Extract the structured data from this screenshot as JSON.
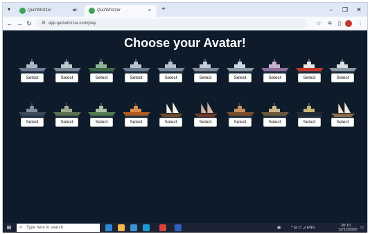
{
  "browser": {
    "tabs": [
      {
        "title": "QuizWhizzer",
        "active": false
      },
      {
        "title": "QuizWhizzer",
        "active": true
      }
    ],
    "tab_menu_icon": "▾",
    "mute_icon": "◀×",
    "close_icon": "×",
    "new_tab_icon": "+",
    "window_controls": {
      "minimize": "–",
      "restore": "❐",
      "close": "✕"
    },
    "nav": {
      "back": "←",
      "forward": "→",
      "reload": "↻"
    },
    "url": "app.quizwhizzer.com/play",
    "site_info_icon": "⚙",
    "toolbar_icons": {
      "bookmark": "☆",
      "reading": "≋",
      "split": "▯",
      "menu": "⋮"
    }
  },
  "page": {
    "heading": "Choose your Avatar!",
    "select_label": "Select",
    "avatars": [
      {
        "ship": "modern-destroyer",
        "hull": "#6b7e95",
        "deck": "#aab8c8"
      },
      {
        "ship": "grey-warship",
        "hull": "#7a8795",
        "deck": "#c0c8d0"
      },
      {
        "ship": "green-patrol-boat",
        "hull": "#3f6b48",
        "deck": "#8fb398"
      },
      {
        "ship": "navy-frigate",
        "hull": "#6a7b8e",
        "deck": "#b9c4d0"
      },
      {
        "ship": "grey-corvette",
        "hull": "#798999",
        "deck": "#b7c1cc"
      },
      {
        "ship": "stealth-boat",
        "hull": "#7d8a98",
        "deck": "#c5ced6"
      },
      {
        "ship": "battleship",
        "hull": "#8a97a5",
        "deck": "#d0d7de"
      },
      {
        "ship": "speed-cruiser",
        "hull": "#8e6f9b",
        "deck": "#c6b4cf"
      },
      {
        "ship": "red-speedboat",
        "hull": "#c0392b",
        "deck": "#e8e8e8"
      },
      {
        "ship": "research-vessel",
        "hull": "#8e99a4",
        "deck": "#d8dde2"
      },
      {
        "ship": "dark-submarine",
        "hull": "#3c4a57",
        "deck": "#7f8c99"
      },
      {
        "ship": "camo-warship",
        "hull": "#5b6e4f",
        "deck": "#9daa8d"
      },
      {
        "ship": "green-gunboat",
        "hull": "#4f7d4f",
        "deck": "#a5c3a0"
      },
      {
        "ship": "wooden-canoe",
        "hull": "#b05a1e",
        "deck": "#d98b4a"
      },
      {
        "ship": "galleon-white-sails",
        "hull": "#6d4a2c",
        "deck": "#f2f0e9"
      },
      {
        "ship": "chinese-junk",
        "hull": "#6a3a2a",
        "deck": "#d6b6a8"
      },
      {
        "ship": "viking-longship",
        "hull": "#7a4e2a",
        "deck": "#c58f5e"
      },
      {
        "ship": "trireme",
        "hull": "#6b5a3a",
        "deck": "#cbb68a"
      },
      {
        "ship": "titanic-liner",
        "hull": "#222a33",
        "deck": "#c7b27a"
      },
      {
        "ship": "raft-with-sail",
        "hull": "#8b6b4a",
        "deck": "#efe8dc"
      }
    ]
  },
  "taskbar": {
    "start_icon": "⊞",
    "search_icon": "⌕",
    "search_placeholder": "Type here to search",
    "apps": [
      "#2b86d8",
      "#f2b84b",
      "#3b91d1",
      "#1a9bd7",
      "#d9433b",
      "#2f5fbf"
    ],
    "tray": {
      "keyboard": "▦",
      "icons": "^  ⊟  ▭  ◿  ENG",
      "time": "20:10",
      "date": "12/12/2020",
      "notifications": "▭"
    }
  }
}
